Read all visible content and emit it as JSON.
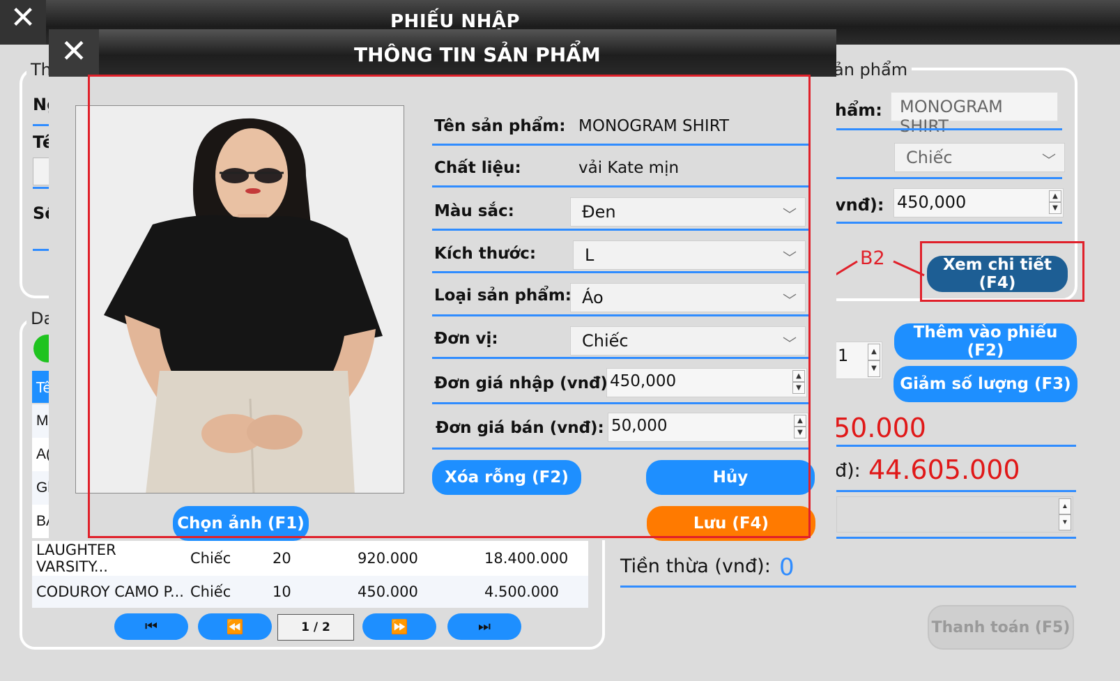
{
  "background_window": {
    "title": "PHIẾU NHẬP",
    "close_glyph": "✕",
    "left_panel_legend": "Th",
    "left_labels": [
      "Ng",
      "Tê",
      "Sổ"
    ],
    "list_panel_legend": "Da",
    "list_header_cell": "Tê",
    "list_partial_rows": [
      "M",
      "A(",
      "Gl",
      "BA"
    ],
    "product_panel_legend": "ản phẩm",
    "product_name_label": "hẩm:",
    "product_name_value": "MONOGRAM SHIRT",
    "unit_value": "Chiếc",
    "price_label": "vnđ):",
    "price_value": "450,000",
    "quantity_value": "1",
    "btn_view_detail": "Xem chi tiết (F4)",
    "btn_add": "Thêm vào phiếu (F2)",
    "btn_decrease": "Giảm số lượng (F3)",
    "total_partial": "50.000",
    "payable_label": "đ):",
    "payable_value": "44.605.000",
    "change_label": "Tiền thừa (vnđ):",
    "change_value": "0",
    "btn_pay": "Thanh toán (F5)",
    "annotation": "B2",
    "table_rows": [
      {
        "name": "LAUGHTER VARSITY...",
        "unit": "Chiếc",
        "qty": "20",
        "price": "920.000",
        "total": "18.400.000"
      },
      {
        "name": "CODUROY CAMO P...",
        "unit": "Chiếc",
        "qty": "10",
        "price": "450.000",
        "total": "4.500.000"
      }
    ],
    "pager": {
      "first": "⏮",
      "prev": "⏪",
      "page": "1 / 2",
      "next": "⏩",
      "last": "⏭"
    }
  },
  "dialog": {
    "title": "THÔNG TIN SẢN PHẨM",
    "close_glyph": "✕",
    "fields": {
      "name_label": "Tên  sản phẩm:",
      "name_value": "MONOGRAM SHIRT",
      "material_label": "Chất liệu:",
      "material_value": "vải Kate mịn",
      "color_label": "Màu sắc:",
      "color_value": "Đen",
      "size_label": "Kích thước:",
      "size_value": "L",
      "type_label": "Loại sản phẩm:",
      "type_value": "Áo",
      "unit_label": "Đơn vị:",
      "unit_value": "Chiếc",
      "import_price_label": "Đơn giá nhập (vnđ):",
      "import_price_value": "450,000",
      "sell_price_label": "Đơn giá bán (vnđ):",
      "sell_price_value": "50,000"
    },
    "btn_clear": "Xóa rỗng (F2)",
    "btn_cancel": "Hủy",
    "btn_save": "Lưu (F4)",
    "btn_choose_image": "Chọn ảnh (F1)"
  },
  "colors": {
    "accent_blue": "#1e8fff",
    "dark_blue": "#1d5e94",
    "orange": "#ff7a00",
    "highlight_red": "#e0202a",
    "money_red": "#e01818"
  }
}
